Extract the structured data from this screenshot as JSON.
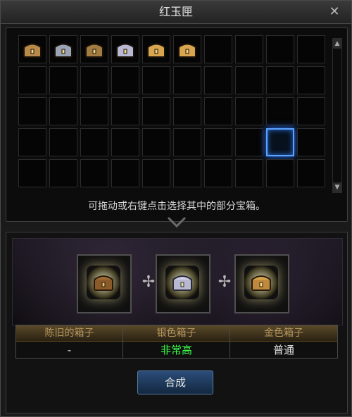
{
  "window": {
    "title": "红玉匣",
    "close_label": "✕"
  },
  "inventory": {
    "hint": "可拖动或右键点击选择其中的部分宝箱。",
    "grid_cols": 10,
    "grid_rows": 5,
    "slots_filled": [
      {
        "type": "old",
        "color": "#b88a4a"
      },
      {
        "type": "old",
        "color": "#9aa4b4"
      },
      {
        "type": "old",
        "color": "#a37c42"
      },
      {
        "type": "silver",
        "color": "#b9b9d4"
      },
      {
        "type": "gold",
        "color": "#d9a64f"
      },
      {
        "type": "gold",
        "color": "#d9a64f"
      }
    ],
    "selected_slot_index": 38
  },
  "combine": {
    "inputs": [
      {
        "name": "陈旧的箱子",
        "value": "-",
        "value_color": "#e2e2e2"
      },
      {
        "name": "银色箱子",
        "value": "非常高",
        "value_color": "#3dff4a"
      },
      {
        "name": "金色箱子",
        "value": "普通",
        "value_color": "#e2e2e2"
      }
    ],
    "button_label": "合成"
  }
}
